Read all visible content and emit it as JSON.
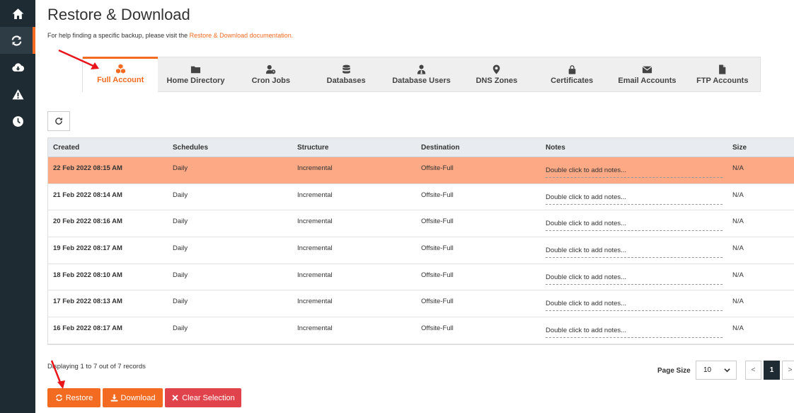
{
  "sidebar": {
    "items": [
      {
        "name": "home",
        "icon": "home-icon"
      },
      {
        "name": "restore",
        "icon": "refresh-icon",
        "active": true
      },
      {
        "name": "backup",
        "icon": "cloud-download-icon"
      },
      {
        "name": "alerts",
        "icon": "warning-icon"
      },
      {
        "name": "schedule",
        "icon": "clock-icon"
      }
    ]
  },
  "header": {
    "title": "Restore & Download",
    "help_text": "For help finding a specific backup, please visit the ",
    "help_link": "Restore & Download documentation."
  },
  "tabs": [
    {
      "label": "Full Account",
      "icon": "cubes-icon",
      "active": true
    },
    {
      "label": "Home Directory",
      "icon": "folder-icon"
    },
    {
      "label": "Cron Jobs",
      "icon": "user-clock-icon"
    },
    {
      "label": "Databases",
      "icon": "database-icon"
    },
    {
      "label": "Database Users",
      "icon": "user-tie-icon"
    },
    {
      "label": "DNS Zones",
      "icon": "map-marker-icon"
    },
    {
      "label": "Certificates",
      "icon": "lock-icon"
    },
    {
      "label": "Email Accounts",
      "icon": "envelope-icon"
    },
    {
      "label": "FTP Accounts",
      "icon": "file-icon"
    }
  ],
  "table": {
    "columns": [
      "Created",
      "Schedules",
      "Structure",
      "Destination",
      "Notes",
      "Size"
    ],
    "rows": [
      {
        "created": "22 Feb 2022 08:15 AM",
        "schedule": "Daily",
        "structure": "Incremental",
        "destination": "Offsite-Full",
        "notes": "Double click to add notes...",
        "size": "N/A",
        "selected": true
      },
      {
        "created": "21 Feb 2022 08:14 AM",
        "schedule": "Daily",
        "structure": "Incremental",
        "destination": "Offsite-Full",
        "notes": "Double click to add notes...",
        "size": "N/A"
      },
      {
        "created": "20 Feb 2022 08:16 AM",
        "schedule": "Daily",
        "structure": "Incremental",
        "destination": "Offsite-Full",
        "notes": "Double click to add notes...",
        "size": "N/A"
      },
      {
        "created": "19 Feb 2022 08:17 AM",
        "schedule": "Daily",
        "structure": "Incremental",
        "destination": "Offsite-Full",
        "notes": "Double click to add notes...",
        "size": "N/A"
      },
      {
        "created": "18 Feb 2022 08:10 AM",
        "schedule": "Daily",
        "structure": "Incremental",
        "destination": "Offsite-Full",
        "notes": "Double click to add notes...",
        "size": "N/A"
      },
      {
        "created": "17 Feb 2022 08:13 AM",
        "schedule": "Daily",
        "structure": "Incremental",
        "destination": "Offsite-Full",
        "notes": "Double click to add notes...",
        "size": "N/A"
      },
      {
        "created": "16 Feb 2022 08:17 AM",
        "schedule": "Daily",
        "structure": "Incremental",
        "destination": "Offsite-Full",
        "notes": "Double click to add notes...",
        "size": "N/A"
      }
    ]
  },
  "footer": {
    "displaying": "Displaying 1 to 7 out of 7 records",
    "page_size_label": "Page Size",
    "page_size_value": "10",
    "pager_prev": "<",
    "pager_current": "1",
    "pager_next": ">"
  },
  "actions": {
    "restore": "Restore",
    "download": "Download",
    "clear": "Clear Selection"
  },
  "colors": {
    "accent": "#f26b21",
    "selected_row": "#fda985",
    "danger": "#e0434b",
    "sidebar": "#1e2b33",
    "annotation_arrow": "#e8161b"
  }
}
